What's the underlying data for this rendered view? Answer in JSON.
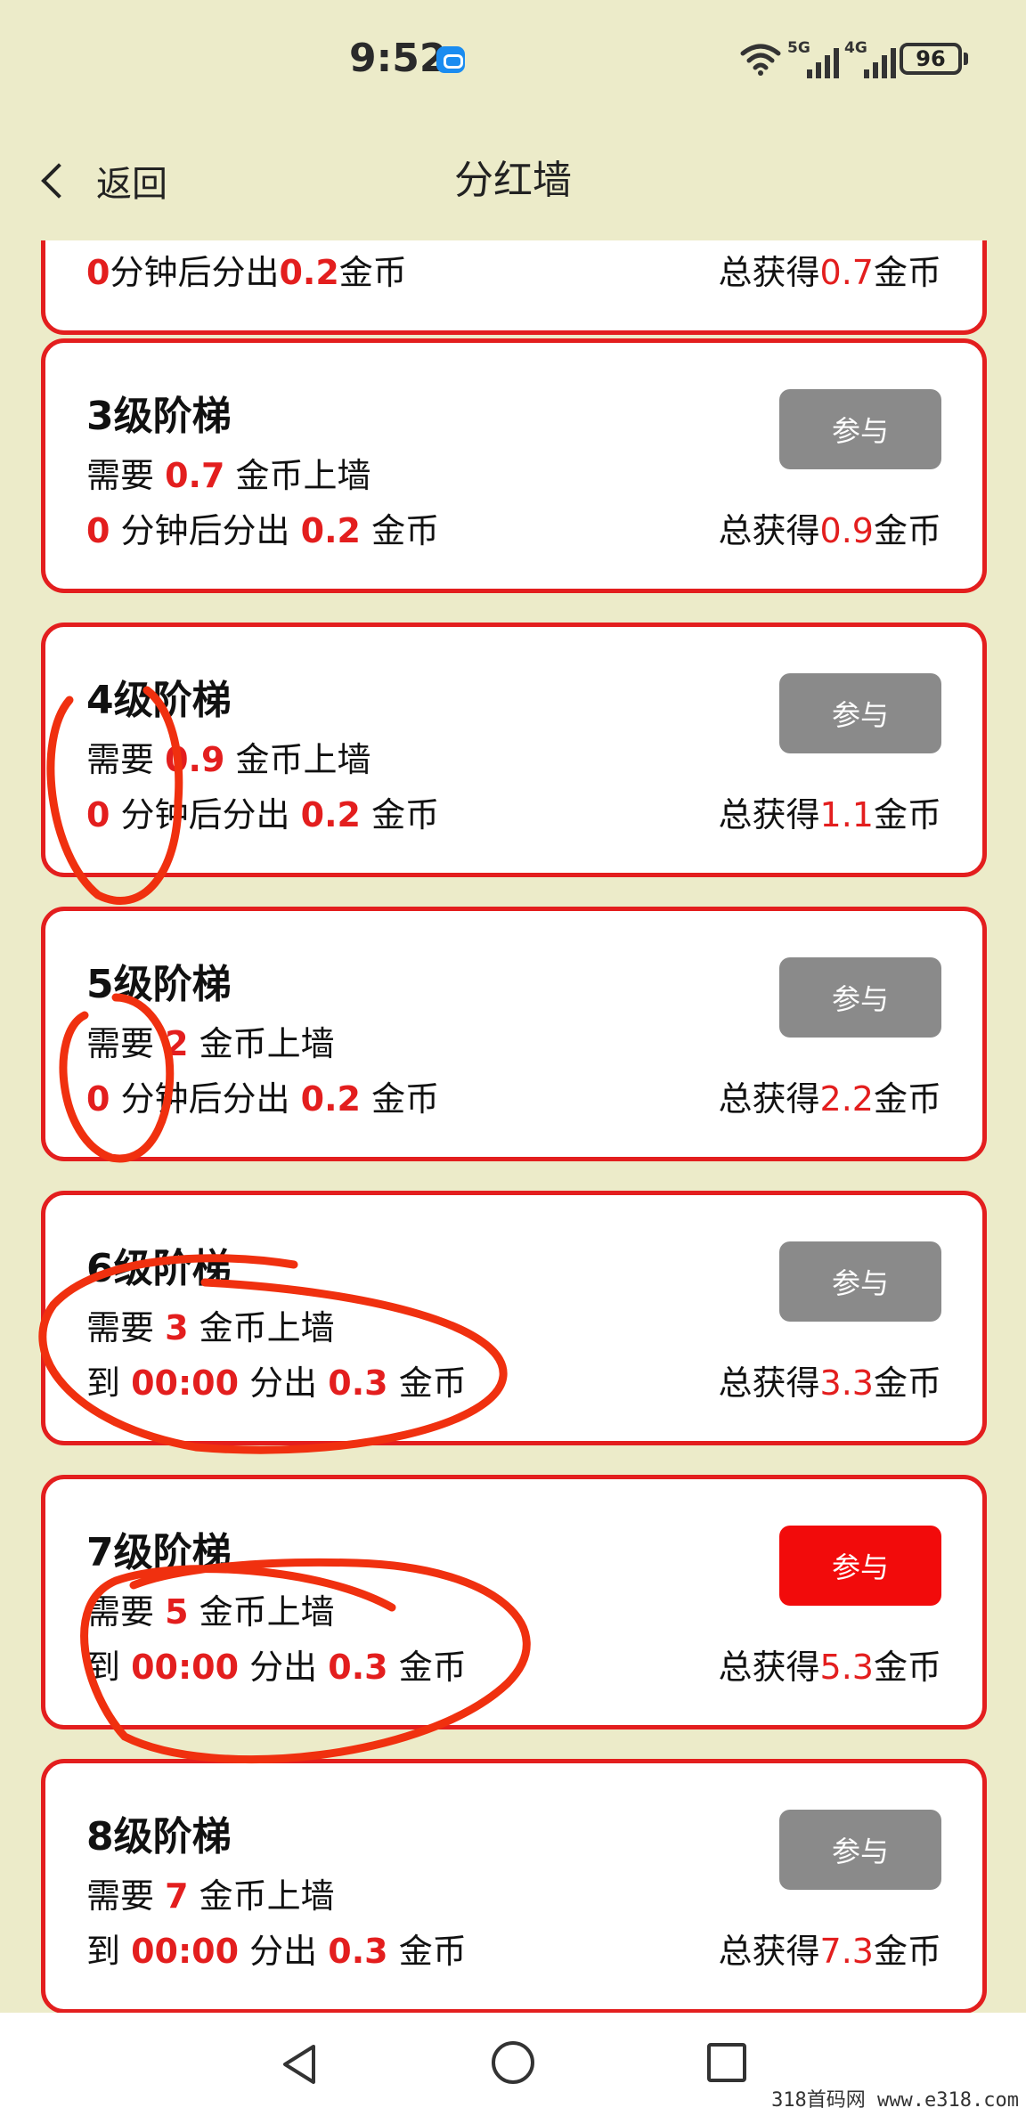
{
  "status_bar": {
    "time": "9:52",
    "network_1": "5G",
    "network_2": "4G",
    "battery": "96"
  },
  "header": {
    "back_label": "返回",
    "title": "分红墙"
  },
  "partial_card": {
    "line2_num": "0",
    "line2_mid": "分钟后分出",
    "line2_amount": "0.2",
    "line2_unit": "金币",
    "total_prefix": "总获得",
    "total_value": "0.7",
    "total_unit": "金币"
  },
  "cards": [
    {
      "title": "3级阶梯",
      "need_prefix": "需要",
      "need_value": "0.7",
      "need_suffix": "金币上墙",
      "pay_prefix": "",
      "pay_value": "0",
      "pay_mid": "分钟后分出",
      "pay_amount": "0.2",
      "pay_unit": "金币",
      "total_prefix": "总获得",
      "total_value": "0.9",
      "total_unit": "金币",
      "button": "参与",
      "active": false
    },
    {
      "title": "4级阶梯",
      "need_prefix": "需要",
      "need_value": "0.9",
      "need_suffix": "金币上墙",
      "pay_prefix": "",
      "pay_value": "0",
      "pay_mid": "分钟后分出",
      "pay_amount": "0.2",
      "pay_unit": "金币",
      "total_prefix": "总获得",
      "total_value": "1.1",
      "total_unit": "金币",
      "button": "参与",
      "active": false
    },
    {
      "title": "5级阶梯",
      "need_prefix": "需要",
      "need_value": "2",
      "need_suffix": "金币上墙",
      "pay_prefix": "",
      "pay_value": "0",
      "pay_mid": "分钟后分出",
      "pay_amount": "0.2",
      "pay_unit": "金币",
      "total_prefix": "总获得",
      "total_value": "2.2",
      "total_unit": "金币",
      "button": "参与",
      "active": false
    },
    {
      "title": "6级阶梯",
      "need_prefix": "需要",
      "need_value": "3",
      "need_suffix": "金币上墙",
      "pay_prefix": "到",
      "pay_value": "00:00",
      "pay_mid": "分出",
      "pay_amount": "0.3",
      "pay_unit": "金币",
      "total_prefix": "总获得",
      "total_value": "3.3",
      "total_unit": "金币",
      "button": "参与",
      "active": false
    },
    {
      "title": "7级阶梯",
      "need_prefix": "需要",
      "need_value": "5",
      "need_suffix": "金币上墙",
      "pay_prefix": "到",
      "pay_value": "00:00",
      "pay_mid": "分出",
      "pay_amount": "0.3",
      "pay_unit": "金币",
      "total_prefix": "总获得",
      "total_value": "5.3",
      "total_unit": "金币",
      "button": "参与",
      "active": true
    },
    {
      "title": "8级阶梯",
      "need_prefix": "需要",
      "need_value": "7",
      "need_suffix": "金币上墙",
      "pay_prefix": "到",
      "pay_value": "00:00",
      "pay_mid": "分出",
      "pay_amount": "0.3",
      "pay_unit": "金币",
      "total_prefix": "总获得",
      "total_value": "7.3",
      "total_unit": "金币",
      "button": "参与",
      "active": false
    }
  ],
  "colors": {
    "background": "#ecebc9",
    "card_border": "#e31e1e",
    "highlight_text": "#e31e1e",
    "button_inactive": "#8a8a8a",
    "button_active": "#f20b0b",
    "annotation": "#f0300f"
  },
  "nav_bar": {
    "icons": [
      "triangle-back-icon",
      "circle-home-icon",
      "square-recent-icon"
    ]
  },
  "watermark": "318首码网  www.e318.com"
}
